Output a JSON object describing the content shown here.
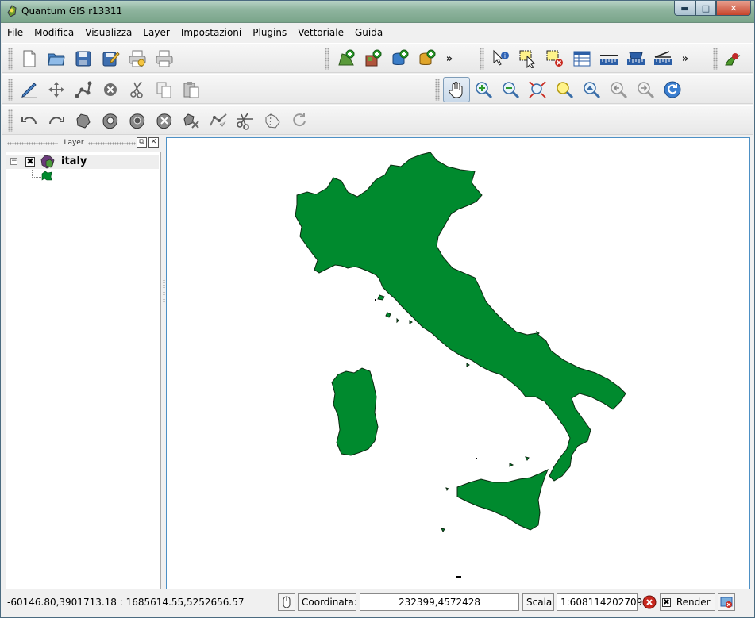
{
  "window": {
    "title": "Quantum GIS r13311"
  },
  "menu": [
    "File",
    "Modifica",
    "Visualizza",
    "Layer",
    "Impostazioni",
    "Plugins",
    "Vettoriale",
    "Guida"
  ],
  "toolbars": {
    "file": [
      "new-project-icon",
      "open-project-icon",
      "save-project-icon",
      "save-as-icon",
      "print-composer-icon",
      "print-icon"
    ],
    "layers": [
      "add-vector-icon",
      "add-raster-icon",
      "add-postgis-icon",
      "add-spatialite-icon"
    ],
    "attributes": [
      "identify-icon",
      "select-icon",
      "deselect-icon",
      "attribute-table-icon",
      "measure-line-icon",
      "measure-area-icon",
      "measure-angle-icon"
    ],
    "plugins": [
      "grass-plugin-icon"
    ],
    "digitizing": [
      "toggle-editing-icon",
      "move-feature-icon",
      "node-tool-icon",
      "delete-selected-icon",
      "cut-features-icon",
      "copy-features-icon",
      "paste-features-icon"
    ],
    "navigation": [
      "pan-icon",
      "zoom-in-icon",
      "zoom-out-icon",
      "zoom-full-icon",
      "zoom-to-selection-icon",
      "zoom-to-layer-icon",
      "zoom-last-icon",
      "zoom-next-icon",
      "refresh-icon"
    ],
    "advanced_digitizing": [
      "undo-icon",
      "redo-icon",
      "simplify-feature-icon",
      "add-ring-icon",
      "add-island-icon",
      "delete-ring-icon",
      "delete-part-icon",
      "reshape-features-icon",
      "split-features-icon",
      "merge-features-icon",
      "rotate-point-symbols-icon"
    ],
    "overflow": "»"
  },
  "layers_panel": {
    "title": "Layer",
    "layers": [
      {
        "name": "italy",
        "visible": true,
        "fill": "#008a2e"
      }
    ]
  },
  "status": {
    "extent": "-60146.80,3901713.18 : 1685614.55,5252656.57",
    "coord_label": "Coordinata:",
    "coord_value": "232399,4572428",
    "scale_label": "Scala",
    "scale_value": "1:608114202709",
    "render_label": "Render",
    "render_checked": true
  },
  "colors": {
    "feature_fill": "#008a2e",
    "canvas_border": "#4d90c5"
  }
}
